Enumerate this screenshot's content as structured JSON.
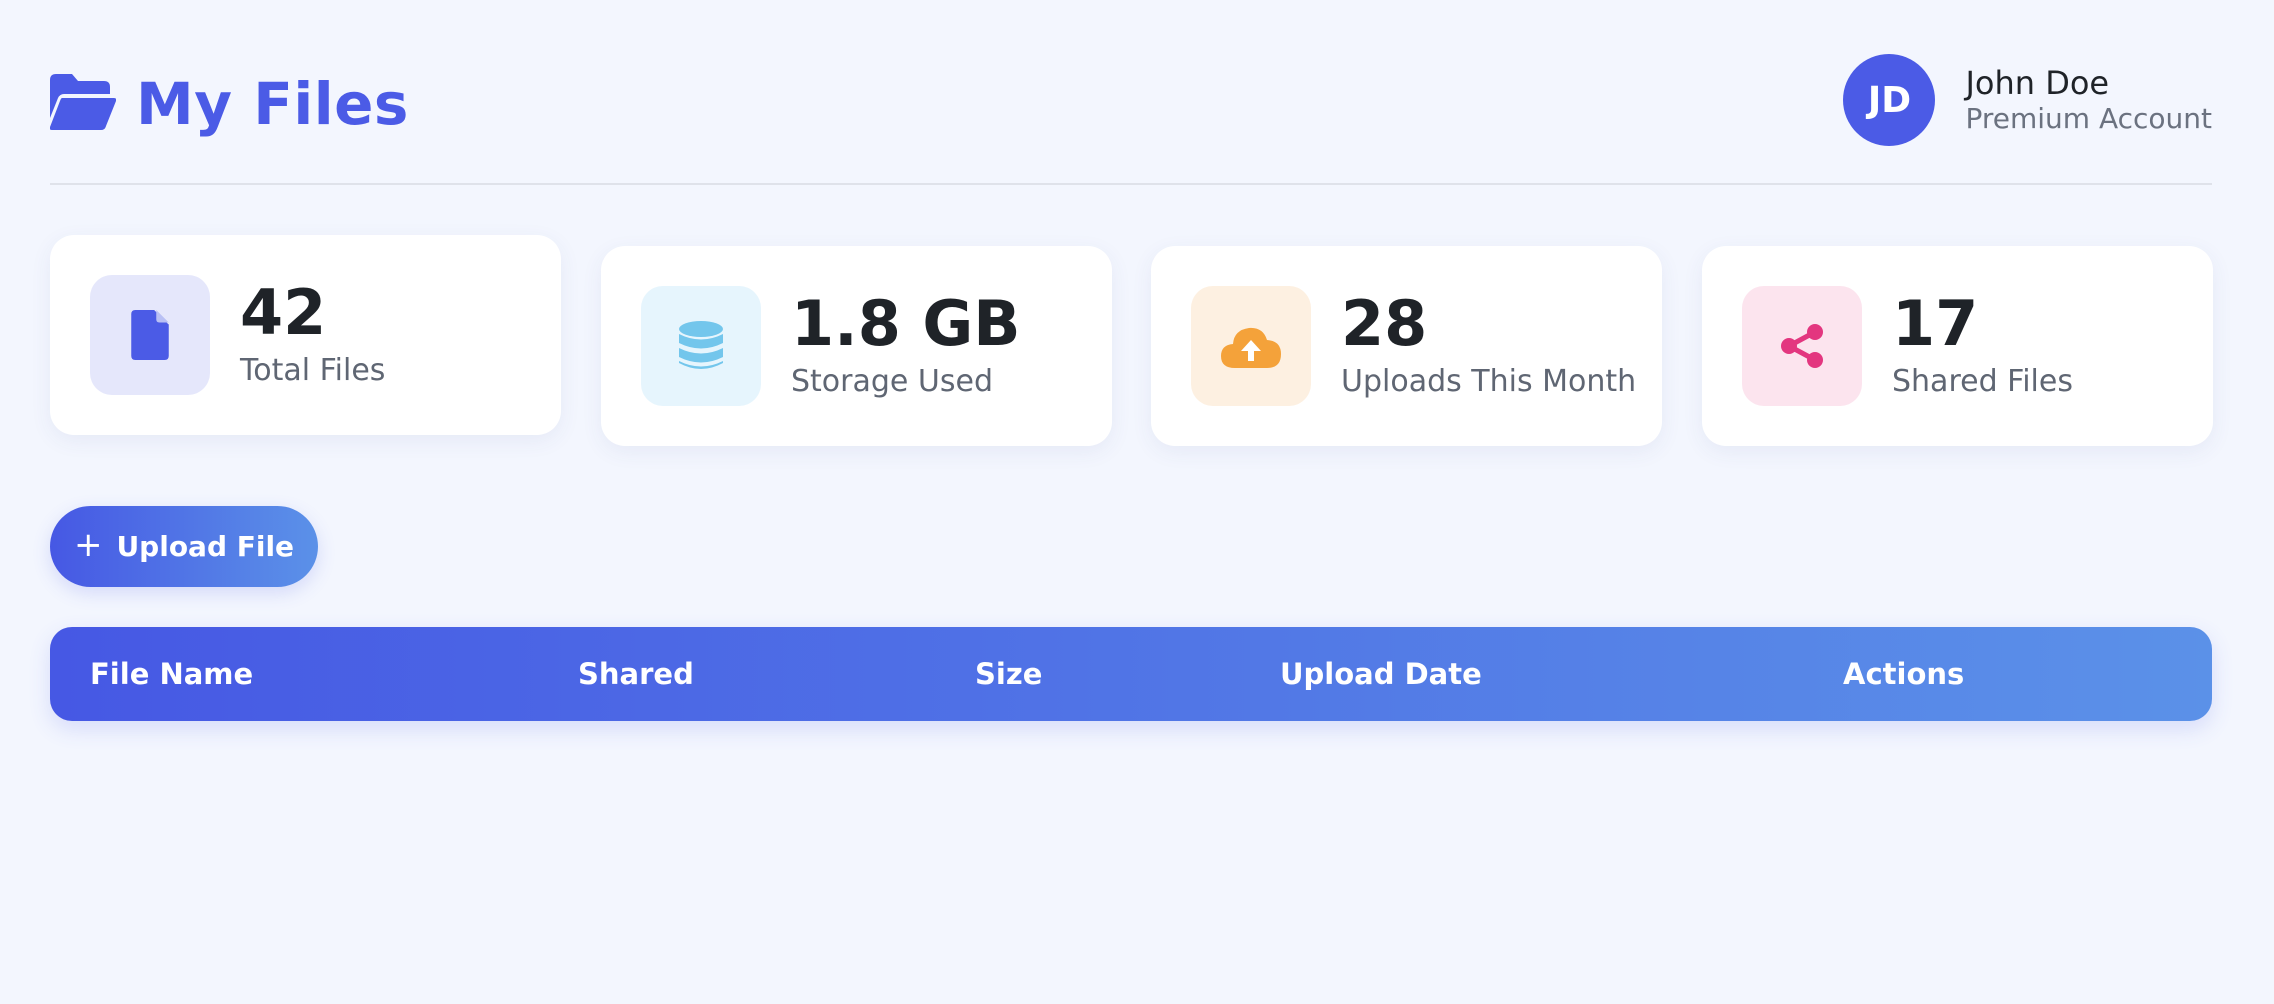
{
  "header": {
    "title": "My Files",
    "icon": "folder-open-icon",
    "brand_color": "#4b5be6"
  },
  "user": {
    "initials": "JD",
    "name": "John Doe",
    "plan": "Premium Account"
  },
  "stats": [
    {
      "value": "42",
      "label": "Total Files",
      "icon": "file-icon",
      "icon_color": "#4b5be6",
      "icon_bg": "#e5e7fb"
    },
    {
      "value": "1.8 GB",
      "label": "Storage Used",
      "icon": "database-icon",
      "icon_color": "#73c6ec",
      "icon_bg": "#e6f5fd"
    },
    {
      "value": "28",
      "label": "Uploads This Month",
      "icon": "cloud-upload-icon",
      "icon_color": "#f4a23a",
      "icon_bg": "#fdf0e1"
    },
    {
      "value": "17",
      "label": "Shared Files",
      "icon": "share-icon",
      "icon_color": "#e3367f",
      "icon_bg": "#fce4ee"
    }
  ],
  "upload_button": {
    "label": "Upload File",
    "icon": "plus-icon"
  },
  "table": {
    "columns": [
      "File Name",
      "Shared",
      "Size",
      "Upload Date",
      "Actions"
    ],
    "rows": []
  },
  "colors": {
    "background": "#f3f6fe",
    "gradient_start": "#4658e4",
    "gradient_end": "#5b91e8"
  }
}
